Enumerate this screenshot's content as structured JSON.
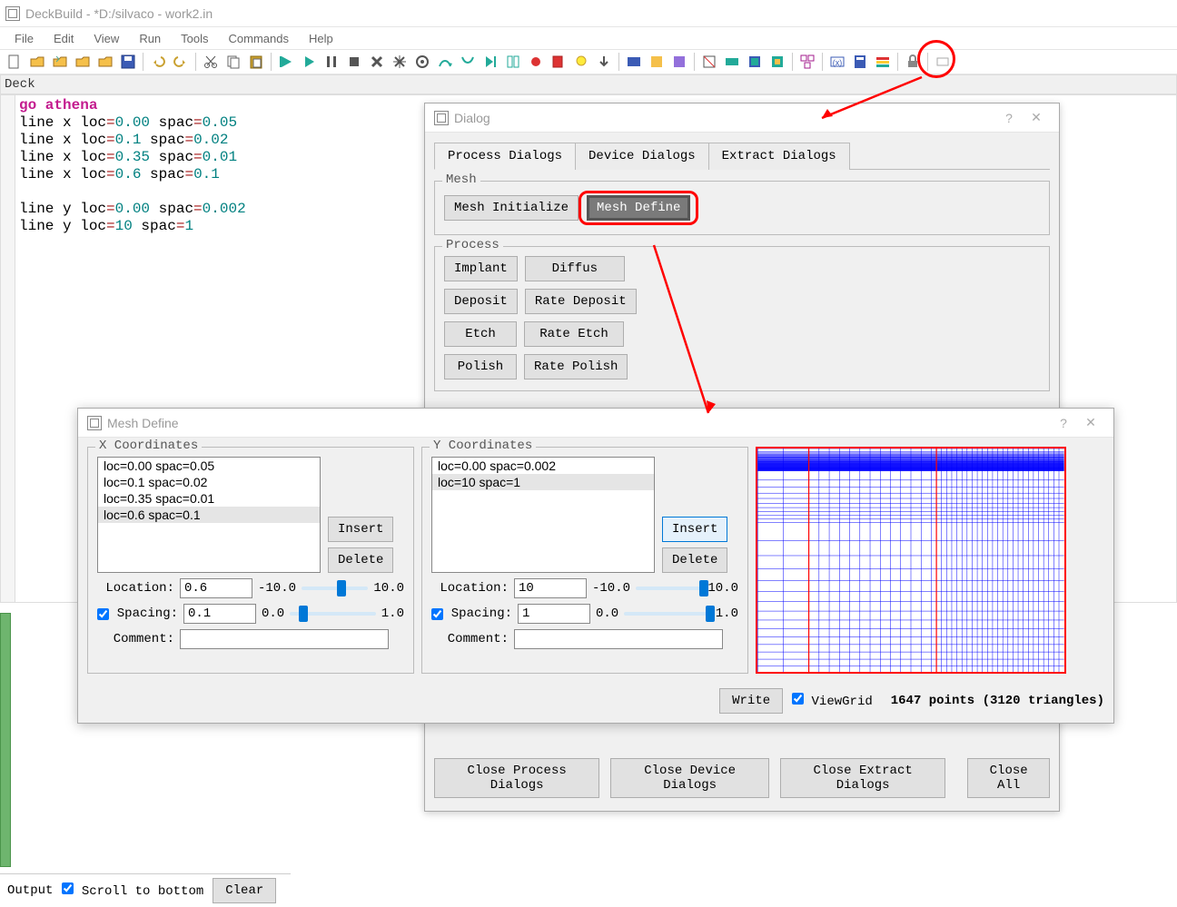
{
  "title": "DeckBuild - *D:/silvaco - work2.in",
  "menus": [
    "File",
    "Edit",
    "View",
    "Run",
    "Tools",
    "Commands",
    "Help"
  ],
  "deckLabel": "Deck",
  "code": [
    {
      "t": "kw",
      "v": "go athena"
    },
    {
      "t": "line",
      "parts": [
        "line x loc",
        "=",
        "0.00",
        " spac",
        "=",
        "0.05"
      ]
    },
    {
      "t": "line",
      "parts": [
        "line x loc",
        "=",
        "0.1",
        " spac",
        "=",
        "0.02"
      ]
    },
    {
      "t": "line",
      "parts": [
        "line x loc",
        "=",
        "0.35",
        " spac",
        "=",
        "0.01"
      ]
    },
    {
      "t": "line",
      "parts": [
        "line x loc",
        "=",
        "0.6",
        " spac",
        "=",
        "0.1"
      ]
    },
    {
      "t": "blank"
    },
    {
      "t": "line",
      "parts": [
        "line y loc",
        "=",
        "0.00",
        " spac",
        "=",
        "0.002"
      ]
    },
    {
      "t": "line",
      "parts": [
        "line y loc",
        "=",
        "10",
        " spac",
        "=",
        "1"
      ]
    }
  ],
  "dialog": {
    "title": "Dialog",
    "tabs": [
      "Process Dialogs",
      "Device Dialogs",
      "Extract Dialogs"
    ],
    "mesh": {
      "legend": "Mesh",
      "init": "Mesh Initialize",
      "define": "Mesh Define"
    },
    "process": {
      "legend": "Process",
      "rows": [
        [
          "Implant",
          "Diffus"
        ],
        [
          "Deposit",
          "Rate Deposit"
        ],
        [
          "Etch",
          "Rate Etch"
        ],
        [
          "Polish",
          "Rate Polish"
        ]
      ]
    },
    "closeRow": [
      "Close Process Dialogs",
      "Close Device Dialogs",
      "Close Extract Dialogs",
      "Close All"
    ]
  },
  "meshDefine": {
    "title": "Mesh Define",
    "x": {
      "legend": "X Coordinates",
      "items": [
        "loc=0.00 spac=0.05",
        "loc=0.1 spac=0.02",
        "loc=0.35 spac=0.01",
        "loc=0.6 spac=0.1"
      ],
      "selected": 3,
      "insert": "Insert",
      "delete": "Delete",
      "locationLabel": "Location:",
      "locationVal": "0.6",
      "locMin": "-10.0",
      "locMax": "10.0",
      "spacingLabel": "Spacing:",
      "spacingVal": "0.1",
      "spMin": "0.0",
      "spMax": "1.0",
      "commentLabel": "Comment:",
      "commentVal": ""
    },
    "y": {
      "legend": "Y Coordinates",
      "items": [
        "loc=0.00 spac=0.002",
        "loc=10 spac=1"
      ],
      "selected": 1,
      "insert": "Insert",
      "delete": "Delete",
      "locationLabel": "Location:",
      "locationVal": "10",
      "locMin": "-10.0",
      "locMax": "10.0",
      "spacingLabel": "Spacing:",
      "spacingVal": "1",
      "spMin": "0.0",
      "spMax": "1.0",
      "commentLabel": "Comment:",
      "commentVal": ""
    },
    "write": "Write",
    "viewGrid": "ViewGrid",
    "stats": "1647 points (3120 triangles)"
  },
  "output": {
    "label": "Output",
    "scroll": "Scroll to bottom",
    "clear": "Clear"
  }
}
